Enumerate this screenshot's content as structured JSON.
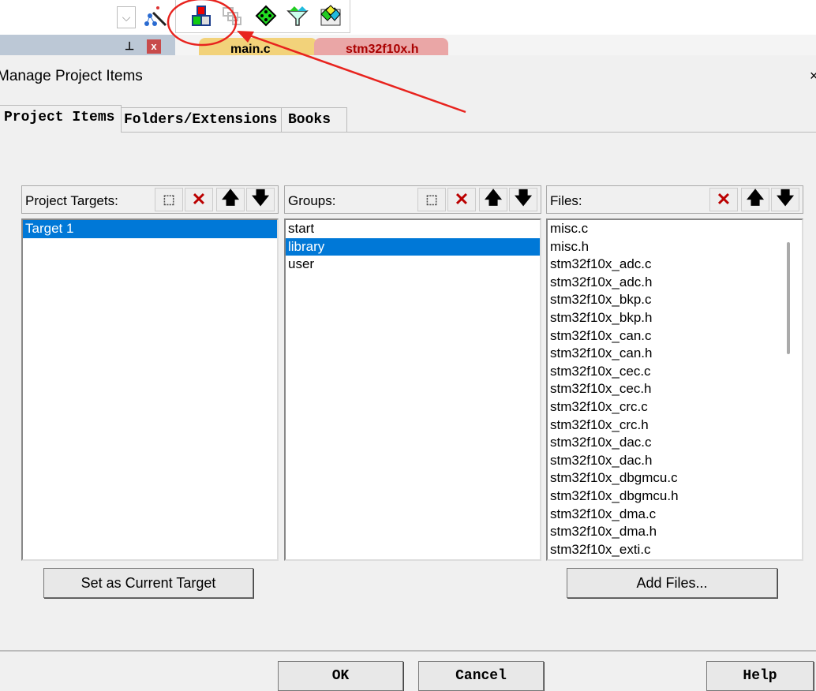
{
  "toolbar": {
    "icons": [
      "dropdown-icon",
      "wizard-icon",
      "manage-project-items-icon",
      "copy-icon",
      "green-diamond-icon",
      "filter-icon",
      "multi-project-icon"
    ]
  },
  "editor_tabs": [
    {
      "label": "main.c"
    },
    {
      "label": "stm32f10x.h"
    }
  ],
  "dialog": {
    "title": "Manage Project Items",
    "tabs": [
      {
        "label": "Project Items",
        "active": true
      },
      {
        "label": "Folders/Extensions"
      },
      {
        "label": "Books"
      }
    ],
    "targets": {
      "label": "Project Targets:",
      "items": [
        "Target 1"
      ],
      "selected": "Target 1"
    },
    "groups": {
      "label": "Groups:",
      "items": [
        "start",
        "library",
        "user"
      ],
      "selected": "library"
    },
    "files": {
      "label": "Files:",
      "items": [
        "misc.c",
        "misc.h",
        "stm32f10x_adc.c",
        "stm32f10x_adc.h",
        "stm32f10x_bkp.c",
        "stm32f10x_bkp.h",
        "stm32f10x_can.c",
        "stm32f10x_can.h",
        "stm32f10x_cec.c",
        "stm32f10x_cec.h",
        "stm32f10x_crc.c",
        "stm32f10x_crc.h",
        "stm32f10x_dac.c",
        "stm32f10x_dac.h",
        "stm32f10x_dbgmcu.c",
        "stm32f10x_dbgmcu.h",
        "stm32f10x_dma.c",
        "stm32f10x_dma.h",
        "stm32f10x_exti.c"
      ]
    },
    "set_current_label": "Set as Current Target",
    "add_files_label": "Add Files...",
    "ok_label": "OK",
    "cancel_label": "Cancel",
    "help_label": "Help"
  },
  "colors": {
    "selection": "#0078d7",
    "annotation": "#e8231e"
  }
}
